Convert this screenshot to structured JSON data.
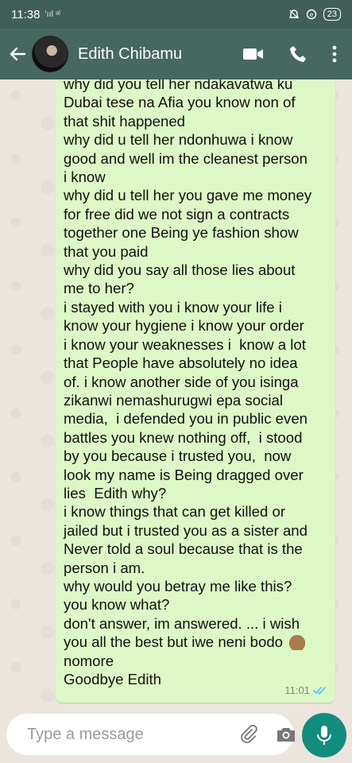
{
  "status_bar": {
    "time": "11:38",
    "signal_text": "'ııl ᵃˡ",
    "battery": "23"
  },
  "app_bar": {
    "contact_name": "Edith Chibamu"
  },
  "message": {
    "lines_part1": "why did you tell her ndakavatwa ku\nDubai tese na Afia you know non of\nthat shit happened\nwhy did u tell her ndonhuwa i know\ngood and well im the cleanest person\ni know\nwhy did u tell her you gave me money\nfor free did we not sign a contracts\ntogether one Being ye fashion show\nthat you paid\nwhy did you say all those lies about\nme to her?\ni stayed with you i know your life i\nknow your hygiene i know your order\ni know your weaknesses i  know a lot\nthat People have absolutely no idea\nof. i know another side of you isinga\nzikanwi nemashurugwi epa social\nmedia,  i defended you in public even\nbattles you knew nothing off,  i stood\nby you because i trusted you,  now\nlook my name is Being dragged over\nlies  Edith why?\ni know things that can get killed or\njailed but i trusted you as a sister and\nNever told a soul because that is the\nperson i am.\nwhy would you betray me like this?\nyou know what?\ndon't answer, im answered. ... i wish\nyou all the best but iwe neni bodo",
    "emoji": "🙌🏾",
    "lines_part2": "nomore\nGoodbye Edith",
    "time": "11:01"
  },
  "input": {
    "placeholder": "Type a message"
  },
  "colors": {
    "header": "#46685f",
    "bubble": "#dcf8c6",
    "mic": "#128c7e",
    "ticks": "#4fc3f7"
  }
}
